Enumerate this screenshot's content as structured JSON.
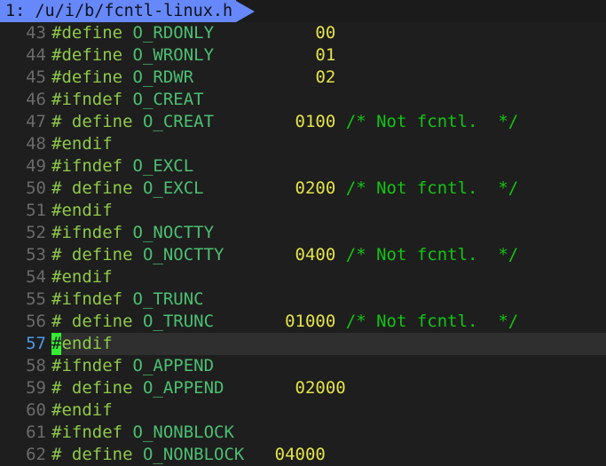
{
  "editor": {
    "name": "vim",
    "background_color": "#1e1e1e",
    "cursorline_color": "#2f2f2f",
    "cursor_color": "#33ee33",
    "linenumber_color": "#6a6a6a",
    "cursor_linenumber_color": "#4e9be8"
  },
  "tabline": {
    "tabs": [
      {
        "label": "1: /u/i/b/fcntl-linux.h",
        "active": true,
        "background_color": "#6688fa",
        "text_color": "#10131c"
      }
    ]
  },
  "cursor": {
    "line": 57,
    "column": 1,
    "char": "#"
  },
  "code": {
    "first_visible_line": 43,
    "last_visible_line": 62,
    "lines": [
      {
        "num": "43",
        "cursor": false,
        "tokens": [
          {
            "t": "#define ",
            "c": "pre"
          },
          {
            "t": "O_RDONLY",
            "c": "id"
          },
          {
            "t": "          ",
            "c": "plain"
          },
          {
            "t": "00",
            "c": "num"
          }
        ]
      },
      {
        "num": "44",
        "cursor": false,
        "tokens": [
          {
            "t": "#define ",
            "c": "pre"
          },
          {
            "t": "O_WRONLY",
            "c": "id"
          },
          {
            "t": "          ",
            "c": "plain"
          },
          {
            "t": "01",
            "c": "num"
          }
        ]
      },
      {
        "num": "45",
        "cursor": false,
        "tokens": [
          {
            "t": "#define ",
            "c": "pre"
          },
          {
            "t": "O_RDWR",
            "c": "id"
          },
          {
            "t": "            ",
            "c": "plain"
          },
          {
            "t": "02",
            "c": "num"
          }
        ]
      },
      {
        "num": "46",
        "cursor": false,
        "tokens": [
          {
            "t": "#ifndef ",
            "c": "pre"
          },
          {
            "t": "O_CREAT",
            "c": "id"
          }
        ]
      },
      {
        "num": "47",
        "cursor": false,
        "tokens": [
          {
            "t": "# define ",
            "c": "pre"
          },
          {
            "t": "O_CREAT",
            "c": "id"
          },
          {
            "t": "        ",
            "c": "plain"
          },
          {
            "t": "0100",
            "c": "num"
          },
          {
            "t": " ",
            "c": "plain"
          },
          {
            "t": "/* Not fcntl.  */",
            "c": "com"
          }
        ]
      },
      {
        "num": "48",
        "cursor": false,
        "tokens": [
          {
            "t": "#endif",
            "c": "pre"
          }
        ]
      },
      {
        "num": "49",
        "cursor": false,
        "tokens": [
          {
            "t": "#ifndef ",
            "c": "pre"
          },
          {
            "t": "O_EXCL",
            "c": "id"
          }
        ]
      },
      {
        "num": "50",
        "cursor": false,
        "tokens": [
          {
            "t": "# define ",
            "c": "pre"
          },
          {
            "t": "O_EXCL",
            "c": "id"
          },
          {
            "t": "         ",
            "c": "plain"
          },
          {
            "t": "0200",
            "c": "num"
          },
          {
            "t": " ",
            "c": "plain"
          },
          {
            "t": "/* Not fcntl.  */",
            "c": "com"
          }
        ]
      },
      {
        "num": "51",
        "cursor": false,
        "tokens": [
          {
            "t": "#endif",
            "c": "pre"
          }
        ]
      },
      {
        "num": "52",
        "cursor": false,
        "tokens": [
          {
            "t": "#ifndef ",
            "c": "pre"
          },
          {
            "t": "O_NOCTTY",
            "c": "id"
          }
        ]
      },
      {
        "num": "53",
        "cursor": false,
        "tokens": [
          {
            "t": "# define ",
            "c": "pre"
          },
          {
            "t": "O_NOCTTY",
            "c": "id"
          },
          {
            "t": "       ",
            "c": "plain"
          },
          {
            "t": "0400",
            "c": "num"
          },
          {
            "t": " ",
            "c": "plain"
          },
          {
            "t": "/* Not fcntl.  */",
            "c": "com"
          }
        ]
      },
      {
        "num": "54",
        "cursor": false,
        "tokens": [
          {
            "t": "#endif",
            "c": "pre"
          }
        ]
      },
      {
        "num": "55",
        "cursor": false,
        "tokens": [
          {
            "t": "#ifndef ",
            "c": "pre"
          },
          {
            "t": "O_TRUNC",
            "c": "id"
          }
        ]
      },
      {
        "num": "56",
        "cursor": false,
        "tokens": [
          {
            "t": "# define ",
            "c": "pre"
          },
          {
            "t": "O_TRUNC",
            "c": "id"
          },
          {
            "t": "       ",
            "c": "plain"
          },
          {
            "t": "01000",
            "c": "num"
          },
          {
            "t": " ",
            "c": "plain"
          },
          {
            "t": "/* Not fcntl.  */",
            "c": "com"
          }
        ]
      },
      {
        "num": "57",
        "cursor": true,
        "tokens": [
          {
            "t": "#",
            "c": "pre",
            "cursor": true
          },
          {
            "t": "endif",
            "c": "pre"
          }
        ]
      },
      {
        "num": "58",
        "cursor": false,
        "tokens": [
          {
            "t": "#ifndef ",
            "c": "pre"
          },
          {
            "t": "O_APPEND",
            "c": "id"
          }
        ]
      },
      {
        "num": "59",
        "cursor": false,
        "tokens": [
          {
            "t": "# define ",
            "c": "pre"
          },
          {
            "t": "O_APPEND",
            "c": "id"
          },
          {
            "t": "       ",
            "c": "plain"
          },
          {
            "t": "02000",
            "c": "num"
          }
        ]
      },
      {
        "num": "60",
        "cursor": false,
        "tokens": [
          {
            "t": "#endif",
            "c": "pre"
          }
        ]
      },
      {
        "num": "61",
        "cursor": false,
        "tokens": [
          {
            "t": "#ifndef ",
            "c": "pre"
          },
          {
            "t": "O_NONBLOCK",
            "c": "id"
          }
        ]
      },
      {
        "num": "62",
        "cursor": false,
        "tokens": [
          {
            "t": "# define ",
            "c": "pre"
          },
          {
            "t": "O_NONBLOCK",
            "c": "id"
          },
          {
            "t": "   ",
            "c": "plain"
          },
          {
            "t": "04000",
            "c": "num"
          }
        ]
      }
    ]
  }
}
